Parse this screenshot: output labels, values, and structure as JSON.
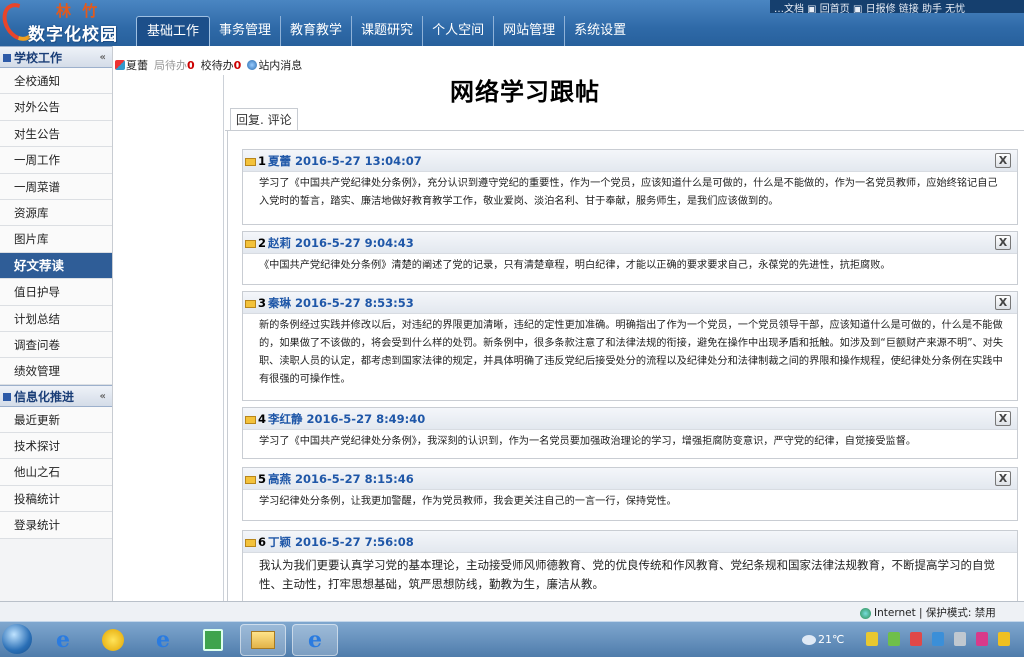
{
  "logo": {
    "line1": "林 竹",
    "line2": "数字化校园"
  },
  "topbar": {
    "text": "…文档 ▣ 回首页 ▣ 日报修 链接 助手 无忧"
  },
  "nav": {
    "items": [
      "基础工作",
      "事务管理",
      "教育教学",
      "课题研究",
      "个人空间",
      "网站管理",
      "系统设置"
    ],
    "active": 0
  },
  "subbar": {
    "user": "夏蕾",
    "dept_todo_label": "局待办",
    "dept_todo_count": "0",
    "school_todo_label": "校待办",
    "school_todo_count": "0",
    "messages": "站内消息"
  },
  "sidebar": {
    "sections": [
      {
        "title": "学校工作",
        "items": [
          "全校通知",
          "对外公告",
          "对生公告",
          "一周工作",
          "一周菜谱",
          "资源库",
          "图片库",
          "好文荐读",
          "值日护导",
          "计划总结",
          "调查问卷",
          "绩效管理"
        ]
      },
      {
        "title": "信息化推进",
        "items": [
          "最近更新",
          "技术探讨",
          "他山之石",
          "投稿统计",
          "登录统计"
        ]
      }
    ],
    "active_item": "好文荐读"
  },
  "page": {
    "title": "网络学习跟帖",
    "tab": "回复. 评论"
  },
  "posts": [
    {
      "num": "1",
      "author": "夏蕾",
      "date": "2016-5-27 13:04:07",
      "body": "学习了《中国共产党纪律处分条例》，充分认识到遵守党纪的重要性，作为一个党员，应该知道什么是可做的，什么是不能做的，作为一名党员教师，应始终铭记自己入党时的誓言，踏实、廉洁地做好教育教学工作，敬业爱岗、淡泊名利、甘于奉献，服务师生，是我们应该做到的。"
    },
    {
      "num": "2",
      "author": "赵莉",
      "date": "2016-5-27 9:04:43",
      "body": "《中国共产党纪律处分条例》清楚的阐述了党的记录，只有清楚章程，明白纪律，才能以正确的要求要求自己，永葆党的先进性，抗拒腐败。"
    },
    {
      "num": "3",
      "author": "秦琳",
      "date": "2016-5-27 8:53:53",
      "body": "新的条例经过实践并修改以后，对违纪的界限更加清晰，违纪的定性更加准确。明确指出了作为一个党员，一个党员领导干部，应该知道什么是可做的，什么是不能做的，如果做了不该做的，将会受到什么样的处罚。新条例中，很多条款注意了和法律法规的衔接，避免在操作中出现矛盾和抵触。如涉及到“巨额财产来源不明”、对失职、渎职人员的认定，都考虑到国家法律的规定，并具体明确了违反党纪后接受处分的流程以及纪律处分和法律制裁之间的界限和操作规程，使纪律处分条例在实践中有很强的可操作性。"
    },
    {
      "num": "4",
      "author": "李红静",
      "date": "2016-5-27 8:49:40",
      "body": "学习了《中国共产党纪律处分条例》，我深刻的认识到，作为一名党员要加强政治理论的学习，增强拒腐防变意识，严守党的纪律，自觉接受监督。"
    },
    {
      "num": "5",
      "author": "高燕",
      "date": "2016-5-27 8:15:46",
      "body": "学习纪律处分条例，让我更加警醒，作为党员教师，我会更关注自己的一言一行，保持党性。"
    },
    {
      "num": "6",
      "author": "丁颖",
      "date": "2016-5-27 7:56:08",
      "body": "我认为我们更要认真学习党的基本理论，主动接受师风师德教育、党的优良传统和作风教育、党纪条规和国家法律法规教育，不断提高学习的自觉性、主动性，打牢思想基础，筑严思想防线，勤教为生，廉洁从教。"
    }
  ],
  "statusbar": {
    "zone": "Internet | 保护模式: 禁用"
  },
  "taskbar": {
    "weather": "21℃"
  },
  "colors": {
    "header": "#2f6aa8",
    "sidebar_active": "#2f5d97",
    "author": "#1f57a8"
  }
}
